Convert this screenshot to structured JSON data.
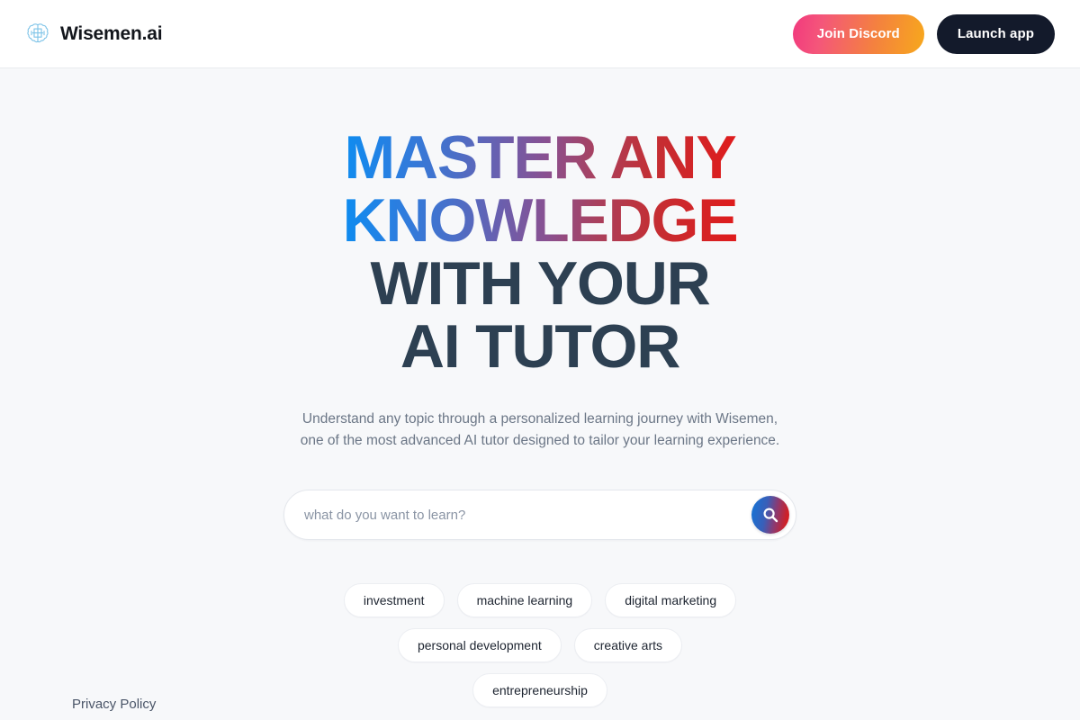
{
  "header": {
    "brand_icon": "brain-icon",
    "brand_name": "Wisemen.ai",
    "discord_button": "Join  Discord",
    "launch_button": "Launch app",
    "discord_gradient_from": "#f2397e",
    "discord_gradient_to": "#f7a81c",
    "launch_bg": "#131a2b"
  },
  "hero": {
    "title_line1": "MASTER ANY",
    "title_line2": "KNOWLEDGE",
    "title_line3": "WITH YOUR",
    "title_line4": "AI TUTOR",
    "title_gradient_from": "#0d8cf0",
    "title_gradient_to": "#e01b1b",
    "title_dark_color": "#2d4052",
    "subtitle_line1": "Understand any topic through a personalized learning journey with Wisemen,",
    "subtitle_line2": "one of the most advanced AI tutor designed to tailor your learning experience."
  },
  "search": {
    "placeholder": "what do you want to learn?",
    "value": "",
    "button_icon": "search-icon",
    "button_gradient_from": "#1175d8",
    "button_gradient_to": "#d8202a"
  },
  "suggestions": [
    {
      "label": "investment"
    },
    {
      "label": "machine learning"
    },
    {
      "label": "digital marketing"
    },
    {
      "label": "personal development"
    },
    {
      "label": "creative arts"
    },
    {
      "label": "entrepreneurship"
    }
  ],
  "footer": {
    "privacy_policy": "Privacy Policy"
  }
}
